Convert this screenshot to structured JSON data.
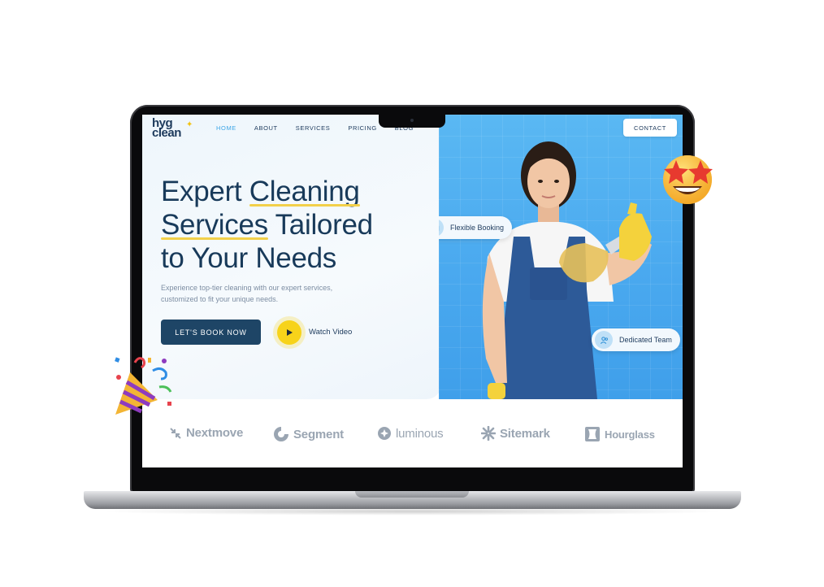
{
  "logo": {
    "line1": "hyg",
    "line2": "clean"
  },
  "nav": [
    {
      "label": "HOME",
      "active": true
    },
    {
      "label": "ABOUT",
      "active": false
    },
    {
      "label": "SERVICES",
      "active": false
    },
    {
      "label": "PRICING",
      "active": false
    },
    {
      "label": "BLOG",
      "active": false
    }
  ],
  "contact_label": "CONTACT",
  "hero": {
    "headline_part1": "Expert ",
    "headline_hl1": "Cleaning",
    "headline_hl2": "Services",
    "headline_part2": " Tailored",
    "headline_part3": "to Your Needs",
    "subtext": "Experience top-tier cleaning with our expert services, customized to fit your unique needs.",
    "book_label": "LET'S BOOK NOW",
    "watch_label": "Watch Video"
  },
  "badges": {
    "flexible": "Flexible Booking",
    "team": "Dedicated Team"
  },
  "brands": [
    "Nextmove",
    "Segment",
    "luminous",
    "Sitemark",
    "Hourglass"
  ],
  "colors": {
    "primary": "#1e4566",
    "accent": "#3fa6e6",
    "highlight": "#f2d04a",
    "play": "#f7d31a",
    "hero_blue": "#4aa9ef"
  },
  "icons": {
    "play": "play-icon",
    "calendar": "calendar-icon",
    "team": "users-icon",
    "star_emoji": "star-struck-emoji",
    "party_emoji": "party-popper-emoji"
  }
}
